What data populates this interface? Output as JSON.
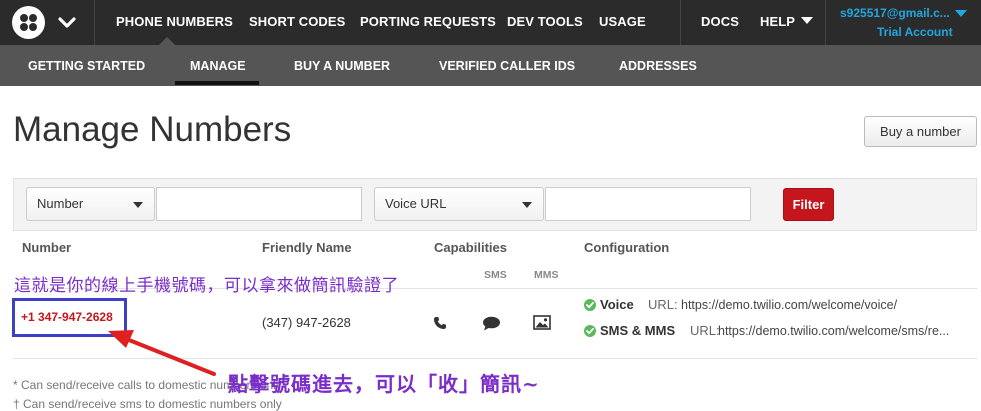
{
  "topnav": {
    "items": [
      {
        "label": "PHONE NUMBERS",
        "active": true
      },
      {
        "label": "SHORT CODES"
      },
      {
        "label": "PORTING REQUESTS"
      },
      {
        "label": "DEV TOOLS"
      },
      {
        "label": "USAGE"
      }
    ],
    "docs_label": "DOCS",
    "help_label": "HELP",
    "account": {
      "email": "s925517@gmail.c...",
      "plan": "Trial Account"
    }
  },
  "subnav": {
    "items": [
      {
        "label": "GETTING STARTED"
      },
      {
        "label": "MANAGE",
        "active": true
      },
      {
        "label": "BUY A NUMBER"
      },
      {
        "label": "VERIFIED CALLER IDS"
      },
      {
        "label": "ADDRESSES"
      }
    ]
  },
  "page": {
    "title": "Manage Numbers",
    "buy_button": "Buy a number"
  },
  "filter": {
    "field1": {
      "selected": "Number",
      "value": ""
    },
    "field2": {
      "selected": "Voice URL",
      "value": ""
    },
    "button": "Filter"
  },
  "table": {
    "headers": {
      "number": "Number",
      "friendly_name": "Friendly Name",
      "capabilities": "Capabilities",
      "configuration": "Configuration"
    },
    "capability_subheaders": [
      "SMS",
      "MMS"
    ],
    "rows": [
      {
        "number": "+1 347-947-2628",
        "friendly_name": "(347) 947-2628",
        "capabilities": [
          "phone-icon",
          "sms-bubble-icon",
          "mms-image-icon"
        ],
        "config": [
          {
            "name": "Voice",
            "label": "URL:",
            "url": "https://demo.twilio.com/welcome/voice/"
          },
          {
            "name": "SMS & MMS",
            "label": "URL:",
            "url": "https://demo.twilio.com/welcome/sms/re..."
          }
        ]
      }
    ]
  },
  "footnotes": [
    "* Can send/receive calls to domestic numbers only",
    "† Can send/receive sms to domestic numbers only"
  ],
  "annotations": {
    "top": "這就是你的線上手機號碼，可以拿來做簡訊驗證了",
    "bottom": "點擊號碼進去，可以「收」簡訊~"
  },
  "colors": {
    "nav_bg": "#2b2b2b",
    "subnav_bg": "#555555",
    "accent_red": "#c4161c",
    "account_blue": "#21a6e0",
    "annotation_purple": "#7a2dc8",
    "annotation_box": "#3d3fc6",
    "arrow_red": "#e02020",
    "check_green": "#5cb85c"
  }
}
